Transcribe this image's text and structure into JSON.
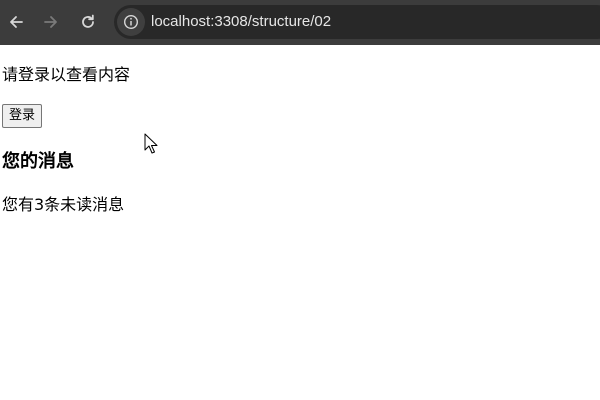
{
  "browser": {
    "url": "localhost:3308/structure/02",
    "icons": {
      "back": "arrow-left-icon",
      "forward": "arrow-right-icon",
      "reload": "reload-icon",
      "site_info": "info-circle-icon"
    }
  },
  "page": {
    "login_prompt": "请登录以查看内容",
    "login_button": "登录",
    "messages_heading": "您的消息",
    "messages_text": "您有3条未读消息"
  }
}
